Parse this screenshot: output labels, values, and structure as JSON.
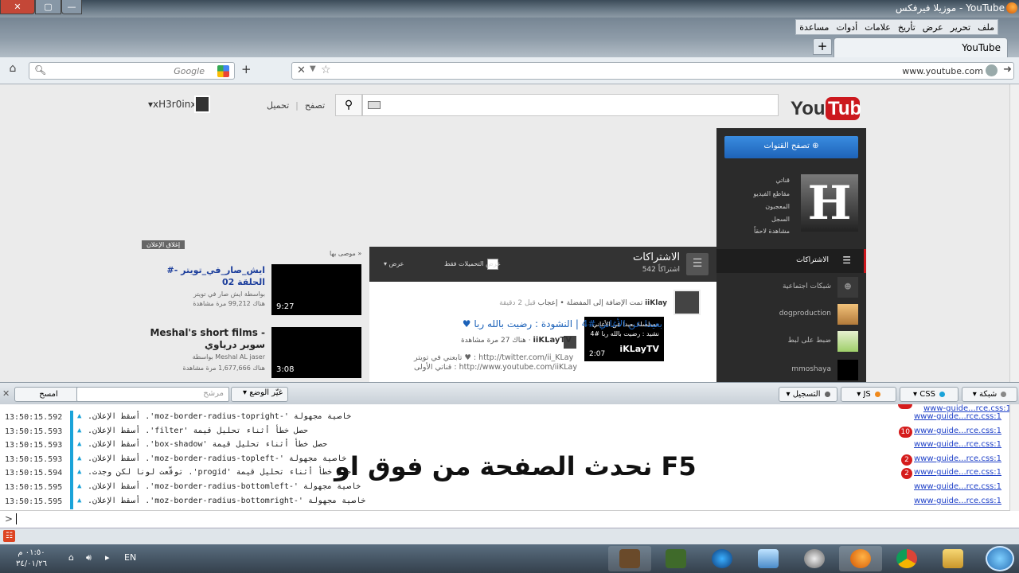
{
  "window": {
    "title": "YouTube - موزيلا فيرفكس",
    "close": "✕",
    "max": "▢",
    "min": "—",
    "ff_icon": "firefox-icon"
  },
  "menu": [
    "ملف",
    "تحرير",
    "عرض",
    "تأريخ",
    "علامات",
    "أدوات",
    "مساعدة"
  ],
  "tab": {
    "label": "YouTube",
    "add": "+"
  },
  "nav": {
    "search_placeholder": "Google",
    "url": "www.youtube.com",
    "home_icon": "home-icon",
    "zoom": "+"
  },
  "youtube": {
    "logo": "YouTube",
    "upload": "تحميل",
    "browse": "تصفح",
    "user": "xH3r0inx",
    "guide": {
      "browse_channels": "تصفح القنوات",
      "avatar_letter": "H",
      "menu": [
        "قناتي",
        "مقاطع الفيديو",
        "المعجبون",
        "السجل",
        "مشاهدة لاحقاً"
      ],
      "subscriptions": "الاشتراكات",
      "rows": [
        "شبكات اجتماعية",
        "dogproduction",
        "ضبط على لبط",
        "mmoshaya"
      ]
    },
    "subs_panel": {
      "title": "الاشتراكات",
      "count": "542 اشتراكاً",
      "uploads_only": "عرض التحميلات فقط",
      "view": "عرض",
      "feed": {
        "user": "iiKlay",
        "action": "تمت الإضافة إلى المفضلة • إعجاب",
        "time": "قبل 2 دقيقة",
        "thumb_text": "مسلسلة بعيدا عن الأغاني\nنشيد : رضيت بالله ربا #4",
        "thumb_overlay": "iKLayTV",
        "duration": "2:07",
        "title": "بعيدا عن الأغاني #4 | النشودة : رضيت بالله ربا ♥",
        "channel": "iiKLayTV",
        "views": "هناك 27 مرة مشاهدة",
        "desc1": "تابعني في تويتر ♥ : http://twitter.com/ii_KLay",
        "desc2": "قناتي الأولى : http://www.youtube.com/iiKLay"
      }
    },
    "recommended_label": "موصى بها »",
    "close_ad": "إغلاق الإعلان",
    "recommended": [
      {
        "title": "#ايش_صار_في_تويتر - الحلقة 02",
        "by": "بواسطة ايش صار في تويتر",
        "views": "هناك 99,212 مرة مشاهدة",
        "duration": "9:27",
        "color": "#1c3e9c"
      },
      {
        "title": "Meshal's short films - سوبر درياوي",
        "by": "بواسطة Meshal AL jaser",
        "views": "هناك 1,677,666 مرة مشاهدة",
        "duration": "3:08",
        "color": "#222"
      }
    ]
  },
  "devtools": {
    "clear": "امسح",
    "filter_placeholder": "مرشح",
    "position": "غيّر الوضع",
    "tabs": {
      "net": "شبكة",
      "css": "CSS",
      "js": "JS",
      "log": "التسجيل"
    }
  },
  "console": [
    {
      "ts": "13:50:15.592",
      "msg": "خاصية مجهولة '-moz-border-radius-topright'.  أسقط الإعلان.",
      "link": "www-guide...rce.css:1",
      "count": ""
    },
    {
      "ts": "13:50:15.593",
      "msg": "حصل خطأ أثناء تحليل قيمة 'filter'.  أسقط الإعلان.",
      "link": "www-guide...rce.css:1",
      "count": "10"
    },
    {
      "ts": "13:50:15.593",
      "msg": "حصل خطأ أثناء تحليل قيمة 'box-shadow'.  أسقط الإعلان.",
      "link": "www-guide...rce.css:1",
      "count": ""
    },
    {
      "ts": "13:50:15.593",
      "msg": "خاصية مجهولة '-moz-border-radius-topleft'.  أسقط الإعلان.",
      "link": "www-guide...rce.css:1",
      "count": "2"
    },
    {
      "ts": "13:50:15.594",
      "msg": "حصل خطأ أثناء تحليل قيمة 'progid'. توقّعت لونا لكن وجدت.",
      "link": "www-guide...rce.css:1",
      "count": "2"
    },
    {
      "ts": "13:50:15.595",
      "msg": "خاصية مجهولة '-moz-border-radius-bottomleft'.  أسقط الإعلان.",
      "link": "www-guide...rce.css:1",
      "count": ""
    },
    {
      "ts": "13:50:15.595",
      "msg": "خاصية مجهولة '-moz-border-radius-bottomright'.  أسقط الإعلان.",
      "link": "www-guide...rce.css:1",
      "count": ""
    }
  ],
  "overlay_text": "F5 نحدث الصفحة من فوق او",
  "prompt": ">",
  "taskbar": {
    "time": "٠١:٥٠ م",
    "date": "٣٤/٠١/٢٦",
    "lang": "EN"
  },
  "colors": {
    "accent": "#1aa3d9",
    "yt_red": "#cc181e",
    "link": "#1c62b9",
    "badge": "#d51c1c"
  }
}
